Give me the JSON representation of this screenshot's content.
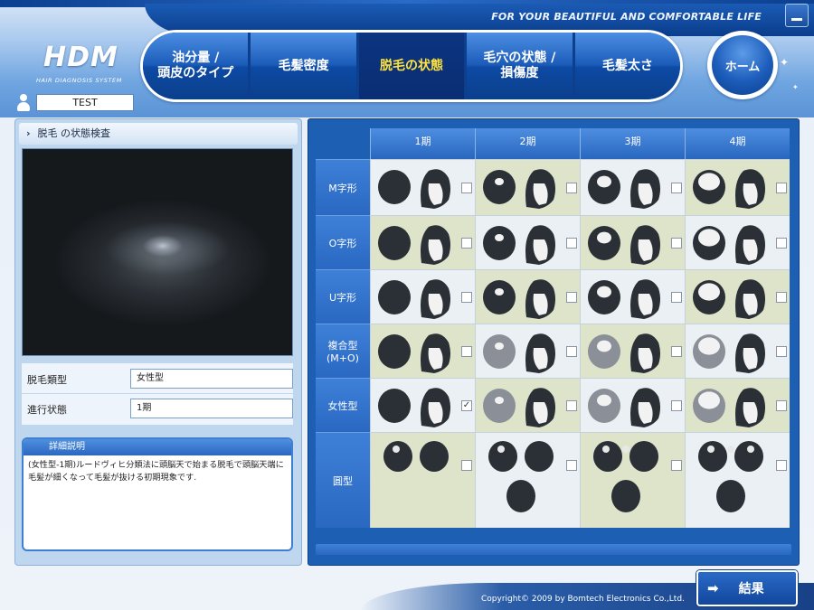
{
  "header": {
    "tagline": "FOR YOUR BEAUTIFUL AND COMFORTABLE LIFE",
    "logo": "HDM",
    "logo_sub": "HAIR DIAGNOSIS SYSTEM",
    "user_name": "TEST",
    "home_label": "ホーム"
  },
  "nav": {
    "items": [
      {
        "label": "油分量 /\n頭皮のタイプ",
        "active": false
      },
      {
        "label": "毛髪密度",
        "active": false
      },
      {
        "label": "脱毛の状態",
        "active": true
      },
      {
        "label": "毛穴の状態 /\n損傷度",
        "active": false
      },
      {
        "label": "毛髪太さ",
        "active": false
      }
    ]
  },
  "left": {
    "section_title": "脱毛 の状態検査",
    "type_label": "脱毛類型",
    "type_value": "女性型",
    "stage_label": "進行状態",
    "stage_value": "1期",
    "detail_title": "詳細説明",
    "detail_text": "(女性型-1期)ルードヴィヒ分類法に頭脳天で始まる脱毛で頭脳天端に毛髪が細くなって毛髪が抜ける初期現象です."
  },
  "grid": {
    "columns": [
      "1期",
      "2期",
      "3期",
      "4期"
    ],
    "rows": [
      {
        "label": "M字形",
        "checked": [
          false,
          false,
          false,
          false
        ]
      },
      {
        "label": "O字形",
        "checked": [
          false,
          false,
          false,
          false
        ]
      },
      {
        "label": "U字形",
        "checked": [
          false,
          false,
          false,
          false
        ]
      },
      {
        "label": "複合型(M+O)",
        "checked": [
          false,
          false,
          false,
          false
        ]
      },
      {
        "label": "女性型",
        "checked": [
          true,
          false,
          false,
          false
        ]
      },
      {
        "label": "圓型",
        "checked": [
          false,
          false,
          false,
          false
        ]
      }
    ]
  },
  "footer": {
    "copyright": "Copyright© 2009 by Bomtech Electronics Co.,Ltd.",
    "result_label": "結果"
  },
  "colors": {
    "accent": "#1c5cba",
    "active_nav_text": "#ffe23a",
    "panel": "#bfd6ef"
  }
}
